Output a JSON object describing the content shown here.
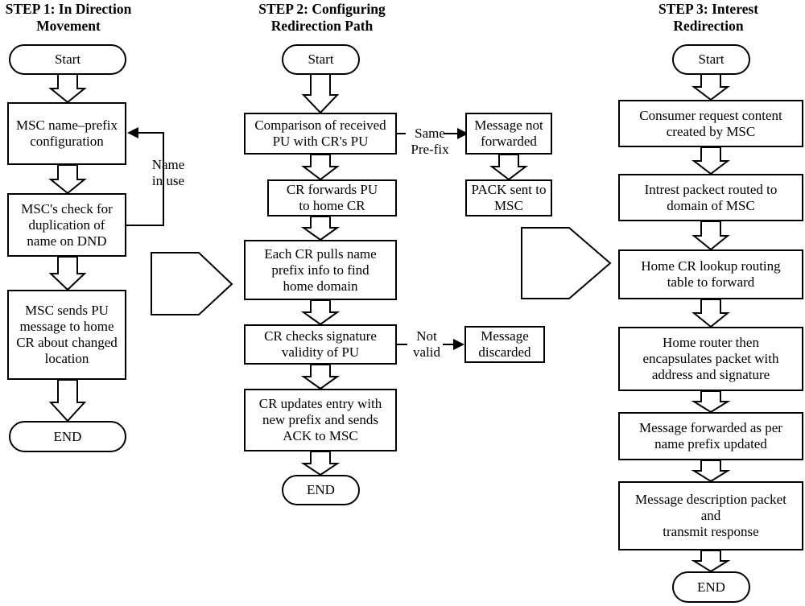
{
  "diagram": {
    "title": "Three-step mobility support flowchart",
    "columns": [
      {
        "id": "step1",
        "title": "STEP 1: In Direction\nMovement",
        "nodes": [
          {
            "id": "s1-start",
            "type": "terminal",
            "label": "Start"
          },
          {
            "id": "s1-b1",
            "type": "process",
            "label": "MSC name–prefix\nconfiguration"
          },
          {
            "id": "s1-b2",
            "type": "process",
            "label": "MSC's check for\nduplication of\nname on DND"
          },
          {
            "id": "s1-b3",
            "type": "process",
            "label": "MSC sends PU\nmessage to home\nCR about changed\nlocation"
          },
          {
            "id": "s1-end",
            "type": "terminal",
            "label": "END"
          }
        ],
        "edge_labels": [
          {
            "id": "s1-loop",
            "label": "Name\nin use"
          }
        ]
      },
      {
        "id": "step2",
        "title": "STEP 2: Configuring\nRedirection Path",
        "nodes": [
          {
            "id": "s2-start",
            "type": "terminal",
            "label": "Start"
          },
          {
            "id": "s2-b1",
            "type": "process",
            "label": "Comparison of received\nPU with CR's PU"
          },
          {
            "id": "s2-b2",
            "type": "process",
            "label": "CR forwards PU\nto home CR"
          },
          {
            "id": "s2-b3",
            "type": "process",
            "label": "Each CR pulls name\nprefix info to find\nhome domain"
          },
          {
            "id": "s2-b4",
            "type": "process",
            "label": "CR checks signature\nvalidity of PU"
          },
          {
            "id": "s2-b5",
            "type": "process",
            "label": "CR updates entry with\nnew prefix and sends\nACK to MSC"
          },
          {
            "id": "s2-end",
            "type": "terminal",
            "label": "END"
          },
          {
            "id": "s2-side1",
            "type": "process",
            "label": "Message not\nforwarded"
          },
          {
            "id": "s2-side2",
            "type": "process",
            "label": "PACK sent to\nMSC"
          },
          {
            "id": "s2-side3",
            "type": "process",
            "label": "Message\ndiscarded"
          }
        ],
        "edge_labels": [
          {
            "id": "s2-branch1",
            "label": "Same\nPre-fix"
          },
          {
            "id": "s2-branch2",
            "label": "Not\nvalid"
          }
        ]
      },
      {
        "id": "step3",
        "title": "STEP 3: Interest\nRedirection",
        "nodes": [
          {
            "id": "s3-start",
            "type": "terminal",
            "label": "Start"
          },
          {
            "id": "s3-b1",
            "type": "process",
            "label": "Consumer request content\ncreated by MSC"
          },
          {
            "id": "s3-b2",
            "type": "process",
            "label": "Intrest packect routed to\ndomain of MSC"
          },
          {
            "id": "s3-b3",
            "type": "process",
            "label": "Home CR lookup routing\ntable to forward"
          },
          {
            "id": "s3-b4",
            "type": "process",
            "label": "Home router then\nencapsulates packet with\naddress and signature"
          },
          {
            "id": "s3-b5",
            "type": "process",
            "label": "Message forwarded as per\nname prefix updated"
          },
          {
            "id": "s3-b6",
            "type": "process",
            "label": "Message description packet\nand\ntransmit response"
          },
          {
            "id": "s3-end",
            "type": "terminal",
            "label": "END"
          }
        ],
        "edge_labels": []
      }
    ],
    "connectors": [
      {
        "id": "pent1",
        "type": "pentagon-arrow",
        "label": ""
      },
      {
        "id": "pent2",
        "type": "pentagon-arrow",
        "label": ""
      }
    ],
    "colors": {
      "stroke": "#000000",
      "fill": "#ffffff",
      "text": "#000000"
    }
  }
}
